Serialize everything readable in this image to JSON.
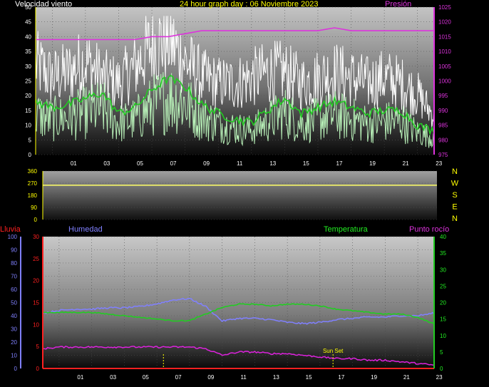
{
  "title": "24 hour graph day : 06 Noviembre 2023",
  "colors": {
    "gust": "#ffffff",
    "wind": "#b8f0b8",
    "avgwind": "#22cc22",
    "pressure": "#dd33dd",
    "direction": "#ffff66",
    "humidity": "#8080ff",
    "temperature": "#22cc22",
    "dewpoint": "#dd22dd",
    "rain": "#ff2020",
    "axis_left": "#ffff00",
    "axis_pressure": "#dd33dd",
    "lluvia_label": "#ff2020",
    "humedad_label": "#8080ff",
    "temperatura_label": "#22ee22",
    "punto_label": "#dd33dd",
    "sunset": "#ffff00"
  },
  "x_ticks": [
    "01",
    "03",
    "05",
    "07",
    "09",
    "11",
    "13",
    "15",
    "17",
    "19",
    "21",
    "23"
  ],
  "panel1": {
    "left_label": "Velocidad viento",
    "right_label": "Presión",
    "left_ticks": [
      "50",
      "45",
      "40",
      "35",
      "30",
      "25",
      "20",
      "15",
      "10",
      "5",
      "0"
    ],
    "right_ticks": [
      "1025",
      "1020",
      "1015",
      "1010",
      "1005",
      "1000",
      "995",
      "990",
      "985",
      "980",
      "975"
    ]
  },
  "panel2": {
    "left_ticks": [
      "360",
      "270",
      "180",
      "90",
      "0"
    ],
    "compass": [
      "N",
      "W",
      "S",
      "E",
      "N"
    ]
  },
  "panel3": {
    "label_rain": "Lluvia",
    "label_humidity": "Humedad",
    "label_temperature": "Temperatura",
    "label_dewpoint": "Punto rocío",
    "humidity_ticks": [
      "100",
      "90",
      "80",
      "70",
      "60",
      "50",
      "40",
      "30",
      "20",
      "10",
      "0"
    ],
    "temp_left_ticks": [
      "30",
      "25",
      "20",
      "15",
      "10",
      "5",
      "0"
    ],
    "right_ticks": [
      "40",
      "35",
      "30",
      "25",
      "20",
      "15",
      "10",
      "5",
      "0"
    ],
    "sunset_label": "Sun Set"
  },
  "chart_data": [
    {
      "type": "line",
      "title": "24 hour graph day : 06 Noviembre 2023",
      "x_hours": [
        0,
        1,
        2,
        3,
        4,
        5,
        6,
        7,
        8,
        9,
        10,
        11,
        12,
        13,
        14,
        15,
        16,
        17,
        18,
        19,
        20,
        21,
        22,
        23,
        24
      ],
      "ylim_left": [
        0,
        50
      ],
      "ylim_right": [
        975,
        1025
      ],
      "series": [
        {
          "name": "Presión",
          "axis": "right",
          "values": [
            1014,
            1014,
            1014,
            1014,
            1014,
            1014,
            1014,
            1015,
            1015,
            1016,
            1017,
            1017,
            1017,
            1017,
            1017,
            1017,
            1017,
            1017,
            1018,
            1017,
            1017,
            1017,
            1017,
            1017,
            1017
          ]
        },
        {
          "name": "Velocidad viento",
          "axis": "left",
          "values": [
            18,
            16,
            17,
            19,
            21,
            14,
            16,
            22,
            26,
            23,
            17,
            14,
            12,
            11,
            15,
            19,
            14,
            16,
            18,
            16,
            14,
            15,
            15,
            10,
            8
          ]
        },
        {
          "name": "Racha",
          "axis": "left",
          "values": [
            33,
            28,
            30,
            34,
            28,
            26,
            32,
            40,
            42,
            34,
            28,
            26,
            26,
            28,
            30,
            30,
            26,
            28,
            30,
            28,
            26,
            28,
            26,
            22,
            14
          ]
        }
      ]
    },
    {
      "type": "line",
      "x_hours": [
        0,
        24
      ],
      "ylim": [
        0,
        360
      ],
      "series": [
        {
          "values": [
            255,
            255
          ]
        }
      ]
    },
    {
      "type": "line",
      "x_hours": [
        0,
        1,
        2,
        3,
        4,
        5,
        6,
        7,
        8,
        9,
        10,
        11,
        12,
        13,
        14,
        15,
        16,
        17,
        18,
        19,
        20,
        21,
        22,
        23,
        24
      ],
      "ylim_humidity": [
        0,
        100
      ],
      "ylim_rain": [
        0,
        30
      ],
      "ylim_temp": [
        0,
        40
      ],
      "series": [
        {
          "name": "Humedad",
          "axis": "humidity",
          "values": [
            42,
            44,
            45,
            45,
            46,
            46,
            47,
            49,
            52,
            53,
            47,
            36,
            38,
            38,
            37,
            35,
            34,
            35,
            37,
            38,
            39,
            39,
            40,
            40,
            42
          ]
        },
        {
          "name": "Temperatura",
          "axis": "temp",
          "values": [
            17,
            17,
            17,
            17,
            16.5,
            16,
            15.5,
            15,
            14.5,
            14.5,
            16.5,
            18.5,
            19.5,
            19.5,
            19,
            19.5,
            19.5,
            19,
            18,
            17.5,
            17,
            16.5,
            16.5,
            15.5,
            13.5
          ]
        },
        {
          "name": "Punto rocío",
          "axis": "temp",
          "values": [
            6,
            6.5,
            6.5,
            6.5,
            6.5,
            6.5,
            6.5,
            6.5,
            6.5,
            6.5,
            6,
            4,
            5,
            5,
            4.5,
            4.5,
            4,
            3.5,
            3,
            3,
            2.5,
            2.5,
            2,
            1.5,
            1
          ]
        },
        {
          "name": "Lluvia",
          "axis": "rain",
          "values": [
            0,
            0,
            0,
            0,
            0,
            0,
            0,
            0,
            0,
            0,
            0,
            0,
            0,
            0,
            0,
            0,
            0,
            0,
            0,
            0,
            0,
            0,
            0,
            0,
            0
          ]
        }
      ],
      "markers": [
        {
          "label": "Sun Set",
          "hour": 17.8
        },
        {
          "label": "",
          "hour": 7.4
        }
      ]
    }
  ]
}
